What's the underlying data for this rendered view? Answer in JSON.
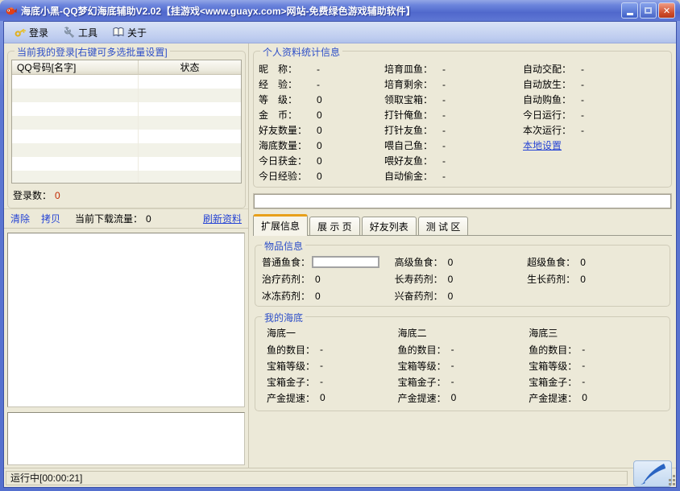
{
  "window": {
    "title": "海底小黑-QQ梦幻海底辅助V2.02【挂游戏<www.guayx.com>网站-免费绿色游戏辅助软件】",
    "accent_titlebar": "#5570CE",
    "accent_close": "#CE4A28"
  },
  "toolbar": {
    "login": "登录",
    "tools": "工具",
    "about": "关于"
  },
  "left": {
    "group_title": "当前我的登录[右键可多选批量设置]",
    "table_columns": [
      "QQ号码[名字]",
      "状态"
    ],
    "login_count_label": "登录数：",
    "login_count": "0",
    "clear": "清除",
    "copy": "拷贝",
    "traffic_label": "当前下载流量：",
    "traffic_value": "0",
    "refresh": "刷新资料"
  },
  "stats": {
    "group_title": "个人资料统计信息",
    "col1": [
      {
        "label": "昵　称：",
        "value": "-"
      },
      {
        "label": "经　验：",
        "value": "-"
      },
      {
        "label": "等　级：",
        "value": "0"
      },
      {
        "label": "金　币：",
        "value": "0"
      },
      {
        "label": "好友数量：",
        "value": "0"
      },
      {
        "label": "海底数量：",
        "value": "0"
      },
      {
        "label": "今日获金：",
        "value": "0"
      },
      {
        "label": "今日经验：",
        "value": "0"
      }
    ],
    "col2": [
      {
        "label": "培育皿鱼：",
        "value": "-"
      },
      {
        "label": "培育剩余：",
        "value": "-"
      },
      {
        "label": "领取宝箱：",
        "value": "-"
      },
      {
        "label": "打针俺鱼：",
        "value": "-"
      },
      {
        "label": "打针友鱼：",
        "value": "-"
      },
      {
        "label": "喂自己鱼：",
        "value": "-"
      },
      {
        "label": "喂好友鱼：",
        "value": "-"
      },
      {
        "label": "自动偷金：",
        "value": "-"
      }
    ],
    "col3": [
      {
        "label": "自动交配：",
        "value": "-"
      },
      {
        "label": "自动放生：",
        "value": "-"
      },
      {
        "label": "自动购鱼：",
        "value": "-"
      },
      {
        "label": "今日运行：",
        "value": "-"
      },
      {
        "label": "本次运行：",
        "value": "-"
      }
    ],
    "local_settings": "本地设置"
  },
  "tabs": [
    "扩展信息",
    "展 示 页",
    "好友列表",
    "测 试 区"
  ],
  "items": {
    "group_title": "物品信息",
    "cells": [
      {
        "label": "普通鱼食：",
        "value": ""
      },
      {
        "label": "高级鱼食：",
        "value": "0"
      },
      {
        "label": "超级鱼食：",
        "value": "0"
      },
      {
        "label": "治疗药剂：",
        "value": "0"
      },
      {
        "label": "长寿药剂：",
        "value": "0"
      },
      {
        "label": "生长药剂：",
        "value": "0"
      },
      {
        "label": "冰冻药剂：",
        "value": "0"
      },
      {
        "label": "兴奋药剂：",
        "value": "0"
      }
    ]
  },
  "seabeds": {
    "group_title": "我的海底",
    "columns": [
      {
        "name": "海底一",
        "rows": [
          {
            "label": "鱼的数目：",
            "value": "-"
          },
          {
            "label": "宝箱等级：",
            "value": "-"
          },
          {
            "label": "宝箱金子：",
            "value": "-"
          },
          {
            "label": "产金提速：",
            "value": "0"
          }
        ]
      },
      {
        "name": "海底二",
        "rows": [
          {
            "label": "鱼的数目：",
            "value": "-"
          },
          {
            "label": "宝箱等级：",
            "value": "-"
          },
          {
            "label": "宝箱金子：",
            "value": "-"
          },
          {
            "label": "产金提速：",
            "value": "0"
          }
        ]
      },
      {
        "name": "海底三",
        "rows": [
          {
            "label": "鱼的数目：",
            "value": "-"
          },
          {
            "label": "宝箱等级：",
            "value": "-"
          },
          {
            "label": "宝箱金子：",
            "value": "-"
          },
          {
            "label": "产金提速：",
            "value": "0"
          }
        ]
      }
    ]
  },
  "statusbar": {
    "text": "运行中[00:00:21]"
  }
}
